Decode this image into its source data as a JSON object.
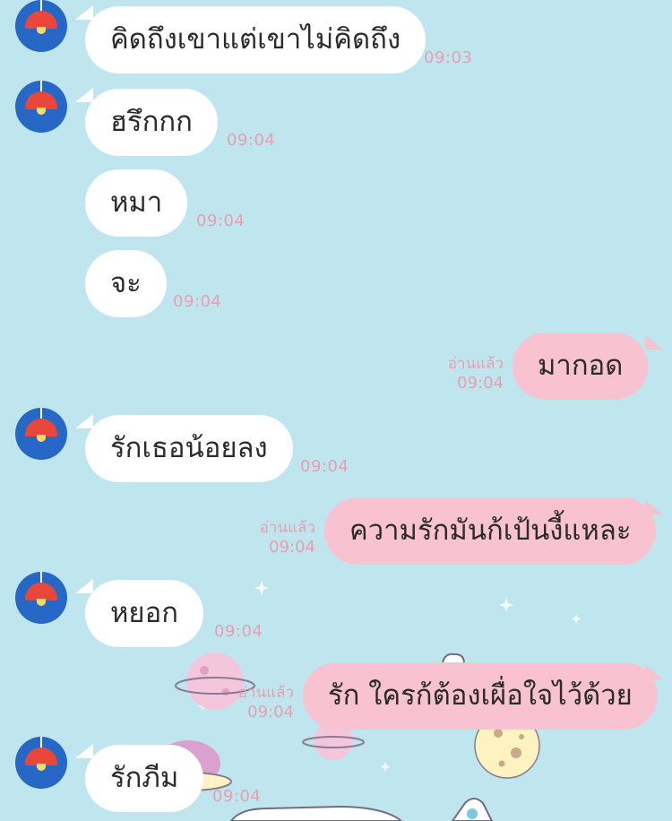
{
  "chat": {
    "read_label": "อ่านแล้ว",
    "messages": [
      {
        "text": "คิดถึงเขาแต่เขาไม่คิดถึง",
        "time": "09:03"
      },
      {
        "text": "ฮรึกกก",
        "time": "09:04"
      },
      {
        "text": "หมา",
        "time": "09:04"
      },
      {
        "text": "จะ",
        "time": "09:04"
      },
      {
        "text": "มากอด",
        "time": "09:04"
      },
      {
        "text": "รักเธอน้อยลง",
        "time": "09:04"
      },
      {
        "text": "ความรักมันก้เป้นงี้แหละ",
        "time": "09:04"
      },
      {
        "text": "หยอก",
        "time": "09:04"
      },
      {
        "text": "รัก ใครก้ต้องเผื่อใจไว้ด้วย",
        "time": "09:04"
      },
      {
        "text": "รักภีม",
        "time": "09:04"
      }
    ]
  },
  "colors": {
    "background": "#bfe6ef",
    "incoming_bubble": "#ffffff",
    "outgoing_bubble": "#f8c2d1",
    "timestamp": "#e6a0b0",
    "avatar_bg": "#2767c6",
    "avatar_lamp": "#e8473a"
  },
  "avatar_icon": "red-lamp-icon",
  "wallpaper_icons": [
    "planet-icon",
    "moon-icon",
    "rocket-icon",
    "sparkle-icon",
    "cat-icon"
  ]
}
